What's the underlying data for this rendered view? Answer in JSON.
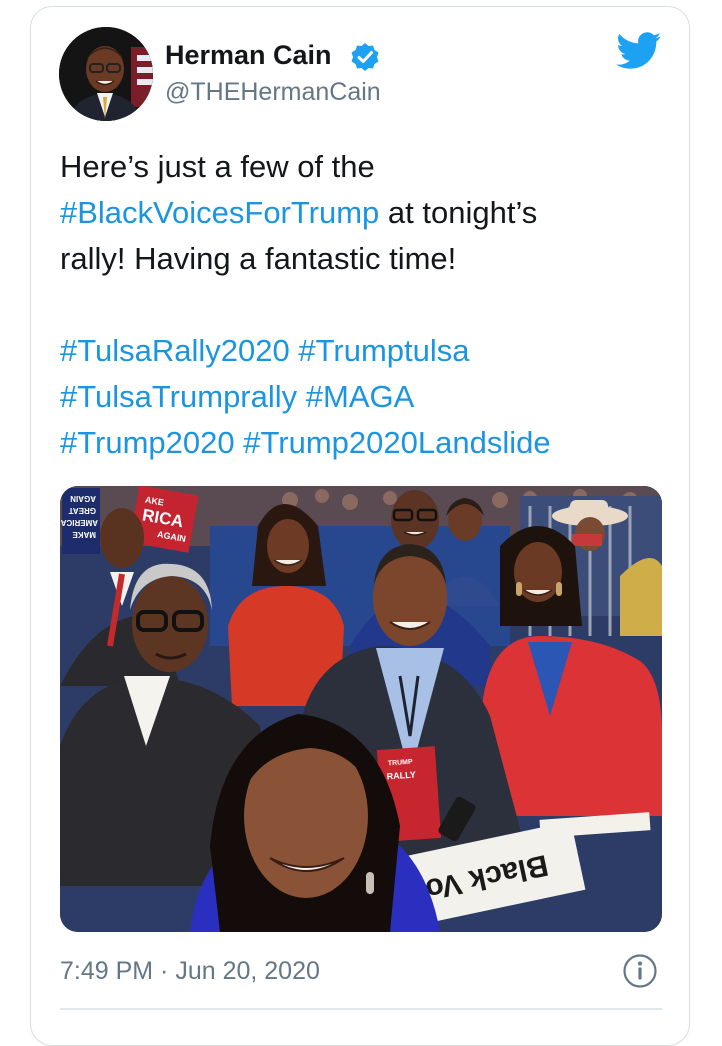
{
  "author": {
    "name": "Herman Cain",
    "handle": "@THEHermanCain",
    "verified_icon": "verified-badge-icon"
  },
  "brand_icon": "twitter-bird-icon",
  "tweet": {
    "lines": [
      [
        {
          "text": "Here’s just a few of the",
          "hashtag": false
        }
      ],
      [
        {
          "text": "#BlackVoicesForTrump",
          "hashtag": true
        },
        {
          "text": " at tonight’s",
          "hashtag": false
        }
      ],
      [
        {
          "text": "rally!  Having a fantastic time!",
          "hashtag": false
        }
      ],
      [],
      [
        {
          "text": "#TulsaRally2020",
          "hashtag": true
        },
        {
          "text": " ",
          "hashtag": false
        },
        {
          "text": "#Trumptulsa",
          "hashtag": true
        }
      ],
      [
        {
          "text": "#TulsaTrumprally",
          "hashtag": true
        },
        {
          "text": " ",
          "hashtag": false
        },
        {
          "text": "#MAGA",
          "hashtag": true
        }
      ],
      [
        {
          "text": "#Trump2020",
          "hashtag": true
        },
        {
          "text": " ",
          "hashtag": false
        },
        {
          "text": "#Trump2020Landslide",
          "hashtag": true
        }
      ]
    ]
  },
  "photo": {
    "sign_left_lines": [
      "MAKE",
      "AMERICA",
      "GREAT",
      "AGAIN"
    ],
    "sign_center_lines": [
      "AKE",
      "RICA",
      "AGAIN"
    ],
    "book_lines": [
      "TRUMP",
      "RALLY"
    ],
    "sign_bottom_text": "Black Vo"
  },
  "footer": {
    "timestamp": "7:49 PM · Jun 20, 2020",
    "info_icon": "info-icon"
  },
  "colors": {
    "text": "#14171a",
    "secondary": "#657786",
    "link": "#1b95e0",
    "twitter_blue": "#1da1f2",
    "border": "#d7dde2"
  }
}
